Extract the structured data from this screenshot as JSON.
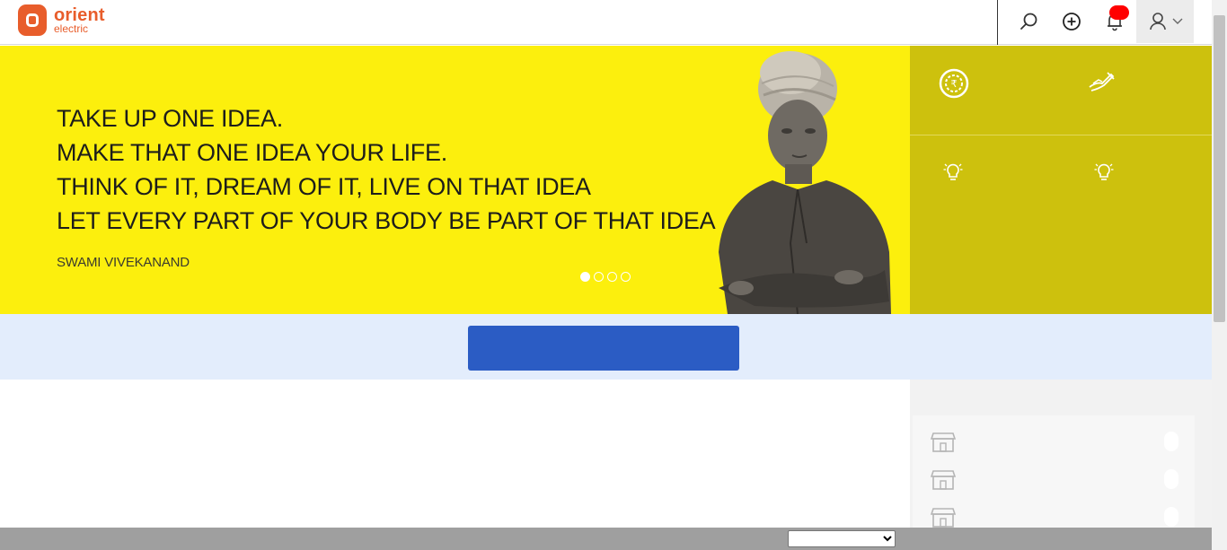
{
  "brand": {
    "name_line1": "orient",
    "name_line2": "electric",
    "color": "#e85d2b"
  },
  "header": {
    "icons": [
      "search-icon",
      "add-circle-icon",
      "bell-icon",
      "user-icon",
      "chevron-down-icon"
    ]
  },
  "hero": {
    "quote_lines": [
      "TAKE UP ONE IDEA.",
      "MAKE THAT ONE IDEA YOUR LIFE.",
      "THINK OF IT, DREAM OF IT, LIVE ON THAT IDEA",
      "LET EVERY PART OF YOUR BODY BE PART OF THAT IDEA"
    ],
    "author": "SWAMI VIVEKANAND",
    "slides_total": 4,
    "active_slide": 1,
    "background": "#fcef0d"
  },
  "tiles": {
    "background": "#cdc10d",
    "icons": [
      "rupee-coin-icon",
      "hand-pen-icon",
      "bulb-icon",
      "bulb-icon"
    ]
  },
  "band": {
    "button_label": "",
    "button_color": "#2b5cc4",
    "background": "#e3edfc"
  },
  "side_panel": {
    "rows": [
      {
        "icon": "store-icon"
      },
      {
        "icon": "store-icon"
      },
      {
        "icon": "store-icon"
      }
    ]
  },
  "footer": {
    "language_select_value": ""
  }
}
